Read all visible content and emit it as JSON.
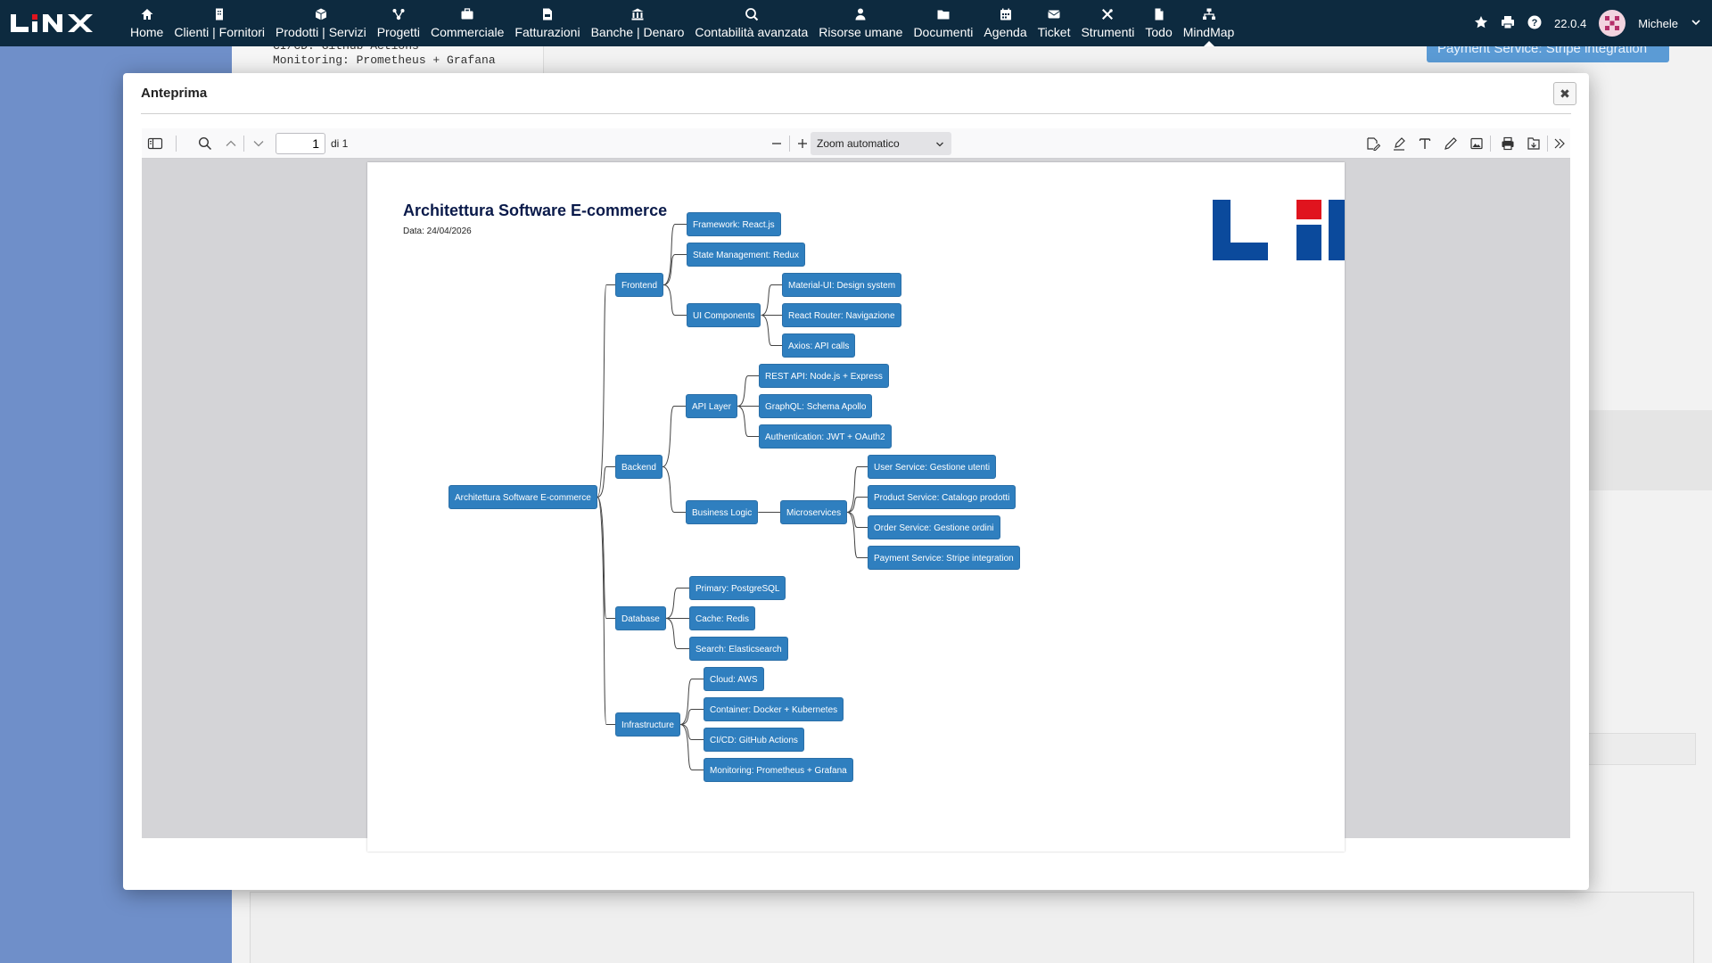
{
  "app": {
    "logo": "LINX",
    "version": "22.0.4",
    "user": "Michele"
  },
  "nav": [
    {
      "id": "home",
      "label": "Home",
      "icon": "home-icon"
    },
    {
      "id": "clienti",
      "label": "Clienti | Fornitori",
      "icon": "building-icon"
    },
    {
      "id": "prodotti",
      "label": "Prodotti | Servizi",
      "icon": "box-icon"
    },
    {
      "id": "progetti",
      "label": "Progetti",
      "icon": "network-icon"
    },
    {
      "id": "commerciale",
      "label": "Commerciale",
      "icon": "briefcase-icon"
    },
    {
      "id": "fatturazioni",
      "label": "Fatturazioni",
      "icon": "file-invoice-icon"
    },
    {
      "id": "banche",
      "label": "Banche | Denaro",
      "icon": "bank-icon"
    },
    {
      "id": "contabilita",
      "label": "Contabilità avanzata",
      "icon": "search-dollar-icon"
    },
    {
      "id": "risorse",
      "label": "Risorse umane",
      "icon": "user-tie-icon"
    },
    {
      "id": "documenti",
      "label": "Documenti",
      "icon": "folder-icon"
    },
    {
      "id": "agenda",
      "label": "Agenda",
      "icon": "calendar-icon"
    },
    {
      "id": "ticket",
      "label": "Ticket",
      "icon": "envelope-icon"
    },
    {
      "id": "strumenti",
      "label": "Strumenti",
      "icon": "tools-icon"
    },
    {
      "id": "todo",
      "label": "Todo",
      "icon": "file-icon"
    },
    {
      "id": "mindmap",
      "label": "MindMap",
      "icon": "sitemap-icon"
    }
  ],
  "background": {
    "code_lines": [
      "CI/CD: GitHub Actions",
      "Monitoring: Prometheus + Grafana"
    ],
    "chip": "Payment Service: Stripe integration"
  },
  "modal": {
    "title": "Anteprima",
    "close": "✖"
  },
  "viewer": {
    "page_current": "1",
    "page_of": "di 1",
    "zoom": "Zoom automatico"
  },
  "document": {
    "title": "Architettura Software E-commerce",
    "date": "Data: 24/04/2026",
    "colors": {
      "node": "#2f7fbf",
      "link": "#444444",
      "logo_blue": "#0b4a9c",
      "logo_red": "#e0141e"
    }
  },
  "mindmap": {
    "root": "Architettura Software E-commerce",
    "frontend": "Frontend",
    "fe_framework": "Framework: React.js",
    "fe_state": "State Management: Redux",
    "fe_ui": "UI Components",
    "fe_ui_material": "Material-UI: Design system",
    "fe_ui_router": "React Router: Navigazione",
    "fe_ui_axios": "Axios: API calls",
    "backend": "Backend",
    "be_api": "API Layer",
    "be_api_rest": "REST API: Node.js + Express",
    "be_api_graphql": "GraphQL: Schema Apollo",
    "be_api_auth": "Authentication: JWT + OAuth2",
    "be_logic": "Business Logic",
    "be_micro": "Microservices",
    "be_ms_user": "User Service: Gestione utenti",
    "be_ms_product": "Product Service: Catalogo prodotti",
    "be_ms_order": "Order Service: Gestione ordini",
    "be_ms_payment": "Payment Service: Stripe integration",
    "database": "Database",
    "db_primary": "Primary: PostgreSQL",
    "db_cache": "Cache: Redis",
    "db_search": "Search: Elasticsearch",
    "infra": "Infrastructure",
    "in_cloud": "Cloud: AWS",
    "in_container": "Container: Docker + Kubernetes",
    "in_cicd": "CI/CD: GitHub Actions",
    "in_monitoring": "Monitoring: Prometheus + Grafana"
  }
}
